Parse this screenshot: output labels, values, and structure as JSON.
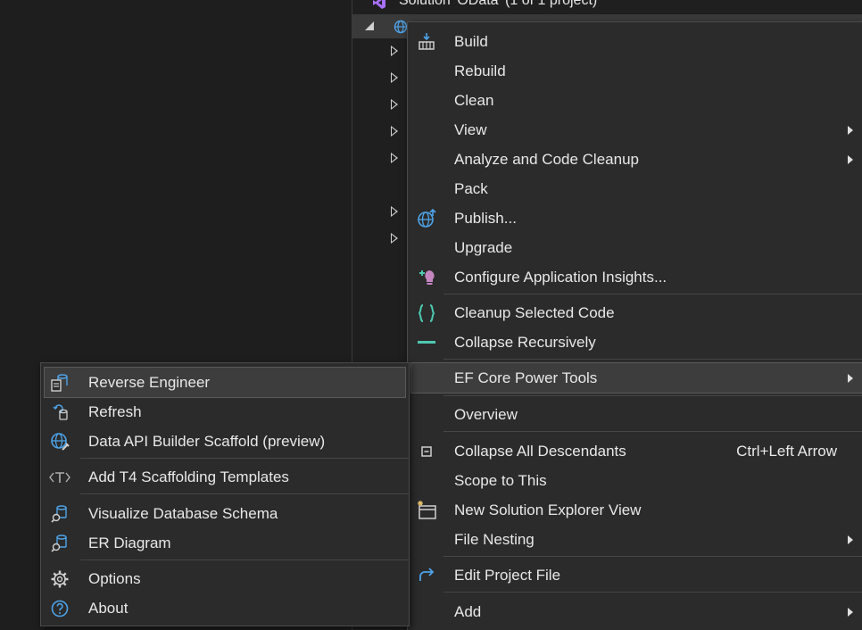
{
  "solution": {
    "label": "Solution 'OData' (1 of 1 project)"
  },
  "main_menu": {
    "items": [
      {
        "label": "Build",
        "icon": "build-icon"
      },
      {
        "label": "Rebuild"
      },
      {
        "label": "Clean"
      },
      {
        "label": "View",
        "submenu": true
      },
      {
        "label": "Analyze and Code Cleanup",
        "submenu": true
      },
      {
        "label": "Pack"
      },
      {
        "label": "Publish...",
        "icon": "publish-globe-icon"
      },
      {
        "label": "Upgrade"
      },
      {
        "label": "Configure Application Insights...",
        "icon": "app-insights-icon"
      },
      {
        "label": "Cleanup Selected Code",
        "icon": "braces-icon"
      },
      {
        "label": "Collapse Recursively",
        "icon": "collapse-bar-icon"
      },
      {
        "label": "EF Core Power Tools",
        "submenu": true,
        "highlighted": true
      },
      {
        "label": "Overview"
      },
      {
        "label": "Collapse All Descendants",
        "shortcut": "Ctrl+Left Arrow",
        "icon": "collapse-all-icon"
      },
      {
        "label": "Scope to This"
      },
      {
        "label": "New Solution Explorer View",
        "icon": "new-explorer-view-icon"
      },
      {
        "label": "File Nesting",
        "submenu": true
      },
      {
        "label": "Edit Project File",
        "icon": "edit-project-arrow-icon"
      },
      {
        "label": "Add",
        "submenu": true
      }
    ]
  },
  "ef_submenu": {
    "items": [
      {
        "label": "Reverse Engineer",
        "icon": "reverse-engineer-icon",
        "highlighted": true
      },
      {
        "label": "Refresh",
        "icon": "refresh-icon"
      },
      {
        "label": "Data API Builder Scaffold (preview)",
        "icon": "data-api-globe-icon"
      },
      {
        "label": "Add T4 Scaffolding Templates",
        "icon": "t4-template-icon"
      },
      {
        "label": "Visualize Database Schema",
        "icon": "database-schema-icon"
      },
      {
        "label": "ER Diagram",
        "icon": "er-diagram-icon"
      },
      {
        "label": "Options",
        "icon": "gear-icon"
      },
      {
        "label": "About",
        "icon": "help-circle-icon"
      }
    ]
  },
  "colors": {
    "background": "#1e1e1e",
    "menu_bg": "#2b2b2b",
    "highlight": "#3d3d3d",
    "accent_blue": "#4ea3e8",
    "accent_teal": "#4ec9b0",
    "accent_purple": "#c586c0"
  }
}
